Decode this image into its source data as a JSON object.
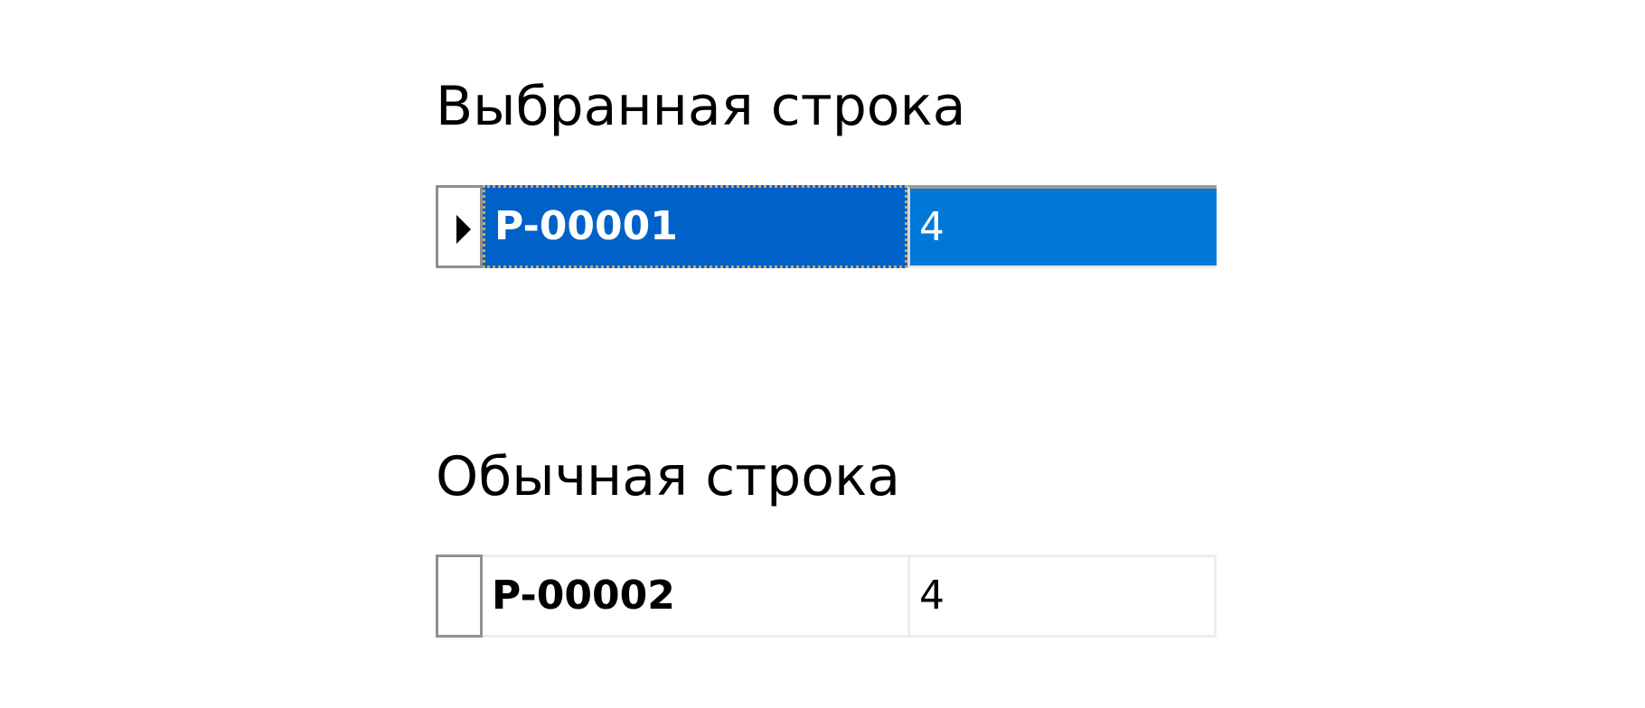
{
  "sections": {
    "selected": {
      "title": "Выбранная строка",
      "row": {
        "code": "P-00001",
        "qty": "4",
        "pointer_icon": "row-pointer-icon"
      }
    },
    "normal": {
      "title": "Обычная строка",
      "row": {
        "code": "P-00002",
        "qty": "4"
      }
    }
  },
  "colors": {
    "selection_focused_cell": "#0061c9",
    "selection_background": "#0078d7",
    "selection_text": "#ffffff",
    "normal_background": "#ffffff",
    "normal_text": "#000000",
    "grid_line": "#eeeeee",
    "row_header_border": "#8d9096"
  }
}
